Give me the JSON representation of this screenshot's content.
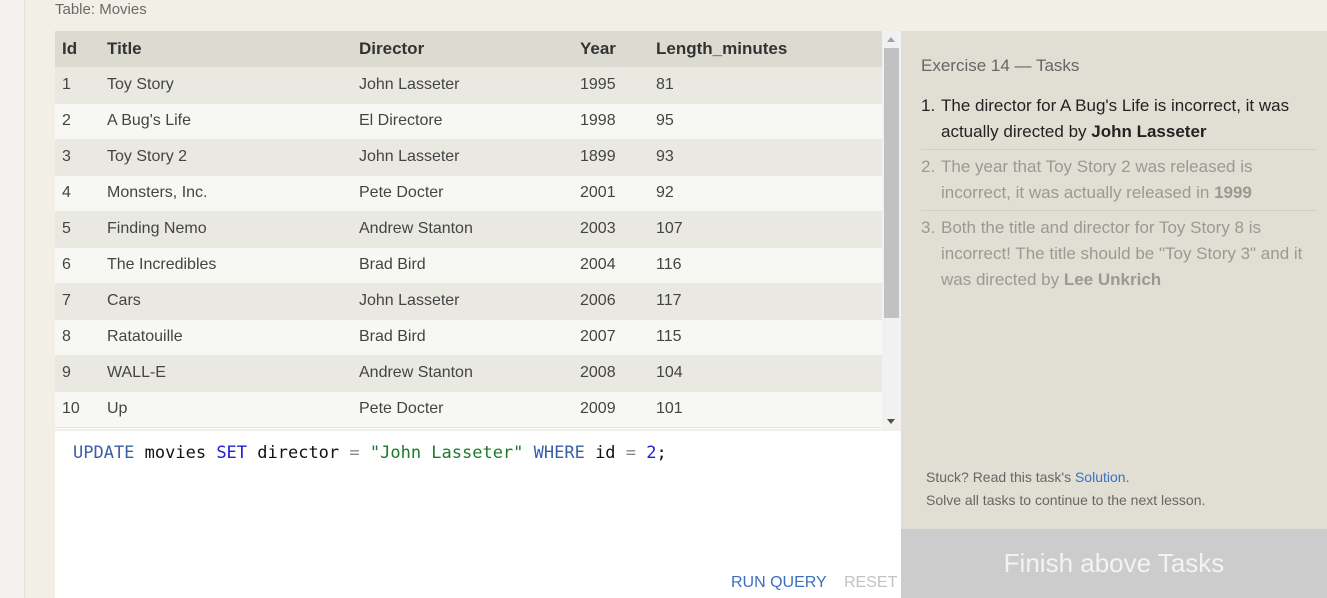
{
  "table_caption": "Table: Movies",
  "table": {
    "columns": [
      "Id",
      "Title",
      "Director",
      "Year",
      "Length_minutes"
    ],
    "rows": [
      [
        "1",
        "Toy Story",
        "John Lasseter",
        "1995",
        "81"
      ],
      [
        "2",
        "A Bug's Life",
        "El Directore",
        "1998",
        "95"
      ],
      [
        "3",
        "Toy Story 2",
        "John Lasseter",
        "1899",
        "93"
      ],
      [
        "4",
        "Monsters, Inc.",
        "Pete Docter",
        "2001",
        "92"
      ],
      [
        "5",
        "Finding Nemo",
        "Andrew Stanton",
        "2003",
        "107"
      ],
      [
        "6",
        "The Incredibles",
        "Brad Bird",
        "2004",
        "116"
      ],
      [
        "7",
        "Cars",
        "John Lasseter",
        "2006",
        "117"
      ],
      [
        "8",
        "Ratatouille",
        "Brad Bird",
        "2007",
        "115"
      ],
      [
        "9",
        "WALL-E",
        "Andrew Stanton",
        "2008",
        "104"
      ],
      [
        "10",
        "Up",
        "Pete Docter",
        "2009",
        "101"
      ]
    ]
  },
  "editor": {
    "query_tokens": {
      "update": "UPDATE",
      "table": " movies ",
      "set": "SET",
      "col": " director ",
      "eq1": "=",
      "value": " \"John Lasseter\" ",
      "where": "WHERE",
      "id": " id ",
      "eq2": "=",
      "num": " 2",
      "semi": ";"
    },
    "run_label": "RUN QUERY",
    "reset_label": "RESET"
  },
  "tasks": {
    "title": "Exercise 14 — Tasks",
    "items": [
      {
        "num": "1.",
        "text": "The director for A Bug's Life is incorrect, it was actually directed by ",
        "bold": "John Lasseter",
        "text_after": ""
      },
      {
        "num": "2.",
        "text": "The year that Toy Story 2 was released is incorrect, it was actually released in ",
        "bold": "1999",
        "text_after": ""
      },
      {
        "num": "3.",
        "text": "Both the title and director for Toy Story 8 is incorrect! The title should be \"Toy Story 3\" and it was directed by ",
        "bold": "Lee Unkrich",
        "text_after": ""
      }
    ],
    "stuck_prefix": "Stuck? Read this task's ",
    "solution_label": "Solution",
    "stuck_suffix": ".",
    "continue_text": "Solve all tasks to continue to the next lesson.",
    "finish_label": "Finish above Tasks"
  },
  "colors": {
    "accent_link": "#3c6fbd",
    "string_green": "#1c7a2a",
    "keyword_blue": "#3a5fa8"
  }
}
